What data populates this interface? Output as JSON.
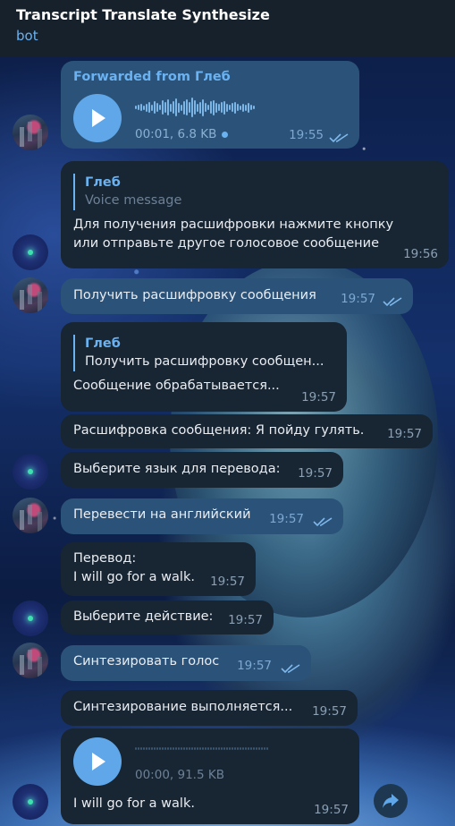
{
  "header": {
    "title": "Transcript Translate Synthesize",
    "subtitle": "bot"
  },
  "messages": {
    "m1": {
      "forwarded": "Forwarded from Глеб",
      "meta": "00:01, 6.8 KB",
      "time": "19:55"
    },
    "m2": {
      "quote_name": "Глеб",
      "quote_text": "Voice message",
      "line1": "Для получения расшифровки нажмите кнопку",
      "line2": "или отправьте другое голосовое сообщение",
      "time": "19:56"
    },
    "m3": {
      "text": "Получить расшифровку сообщения",
      "time": "19:57"
    },
    "m4": {
      "quote_name": "Глеб",
      "quote_text": "Получить расшифровку сообщен...",
      "text": "Сообщение обрабатывается...",
      "time": "19:57"
    },
    "m5": {
      "text": "Расшифровка сообщения:  Я пойду гулять.",
      "time": "19:57"
    },
    "m6": {
      "text": "Выберите язык для перевода:",
      "time": "19:57"
    },
    "m7": {
      "text": "Перевести на английский",
      "time": "19:57"
    },
    "m8": {
      "line1": "Перевод:",
      "line2": "I will go for a walk.",
      "time": "19:57"
    },
    "m9": {
      "text": "Выберите действие:",
      "time": "19:57"
    },
    "m10": {
      "text": "Синтезировать голос",
      "time": "19:57"
    },
    "m11": {
      "text": "Синтезирование выполняется...",
      "time": "19:57"
    },
    "m12": {
      "meta": "00:00, 91.5 KB",
      "caption": "I will go for a walk.",
      "time": "19:57"
    }
  },
  "icons": {
    "play": "play-icon",
    "read": "double-check-icon",
    "share": "share-arrow-icon"
  },
  "colors": {
    "outgoing_bubble": "#2b5278",
    "incoming_bubble": "#182533",
    "accent": "#6ab2f2"
  }
}
